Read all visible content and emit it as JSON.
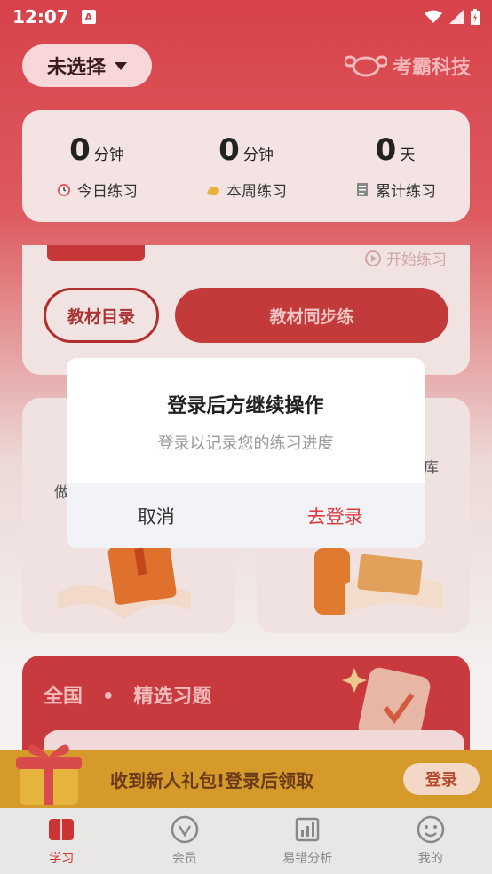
{
  "status_bar": {
    "time": "12:07",
    "notification_icon": "A"
  },
  "header": {
    "selector_label": "未选择",
    "brand": "考霸科技"
  },
  "stats": [
    {
      "value": "0",
      "unit": "分钟",
      "label": "今日练习",
      "icon": "alarm-clock-icon"
    },
    {
      "value": "0",
      "unit": "分钟",
      "label": "本周练习",
      "icon": "muscle-icon"
    },
    {
      "value": "0",
      "unit": "天",
      "label": "累计练习",
      "icon": "notepad-icon"
    }
  ],
  "study": {
    "start_label": "开始练习",
    "catalog_button": "教材目录",
    "sync_button": "教材同步练"
  },
  "grid": {
    "left_partial_text": "做",
    "right_partial_text": "库"
  },
  "featured": {
    "title_region": "全国",
    "title_dot": "•",
    "title_main": "精选习题",
    "inner_partial": "..."
  },
  "gift_banner": {
    "text": "收到新人礼包!登录后领取",
    "login_button": "登录"
  },
  "tabs": [
    {
      "label": "学习",
      "icon": "book-icon",
      "active": true
    },
    {
      "label": "会员",
      "icon": "vip-icon",
      "active": false
    },
    {
      "label": "易错分析",
      "icon": "chart-icon",
      "active": false
    },
    {
      "label": "我的",
      "icon": "smiley-icon",
      "active": false
    }
  ],
  "dialog": {
    "title": "登录后方继续操作",
    "subtitle": "登录以记录您的练习进度",
    "cancel": "取消",
    "confirm": "去登录"
  }
}
